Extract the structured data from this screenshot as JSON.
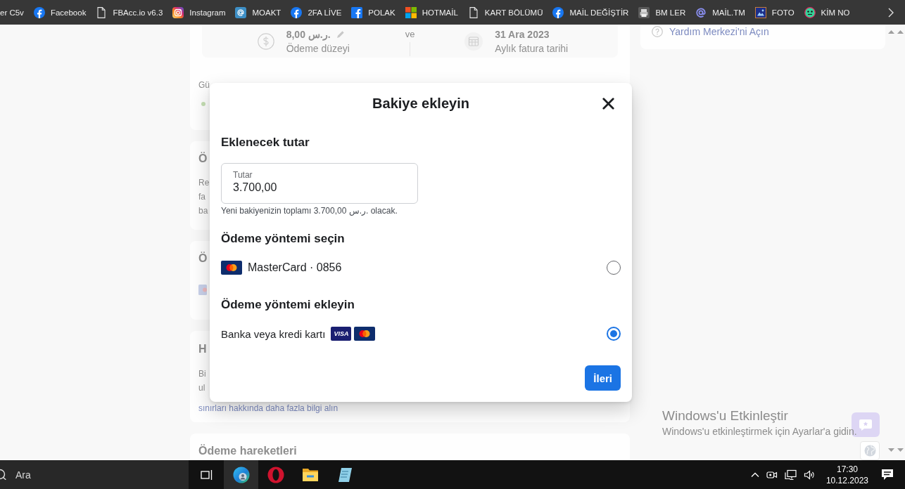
{
  "bookmarks_bar": {
    "items": [
      {
        "kind": "none",
        "label": "er C5v"
      },
      {
        "kind": "facebook",
        "label": "Facebook"
      },
      {
        "kind": "document",
        "label": "FBAcc.io v6.3"
      },
      {
        "kind": "instagram",
        "label": "Instagram"
      },
      {
        "kind": "at",
        "label": "MOAKT"
      },
      {
        "kind": "facebook",
        "label": "2FA LİVE"
      },
      {
        "kind": "square",
        "label": "POLAK"
      },
      {
        "kind": "windows",
        "label": "HOTMAİL"
      },
      {
        "kind": "document",
        "label": "KART BÖLÜMÜ"
      },
      {
        "kind": "facebook",
        "label": "MAİL DEĞİŞTİR"
      },
      {
        "kind": "printer",
        "label": "BM LER"
      },
      {
        "kind": "mention",
        "label": "MAİL.TM"
      },
      {
        "kind": "picture",
        "label": "FOTO"
      },
      {
        "kind": "smiley",
        "label": "KİM NO"
      }
    ]
  },
  "billing_page": {
    "summary_card": {
      "payment_level": {
        "value": "8,00 ر.س.",
        "label": "Ödeme düzeyi"
      },
      "separator": "ve",
      "billing_date": {
        "value": "31 Ara 2023",
        "label": "Aylık fatura tarihi"
      },
      "spending_limit": "Gü"
    },
    "cards": [
      {
        "kind": "text",
        "title": "Ö",
        "lines": [
          "Re",
          "fa",
          "ba"
        ]
      },
      {
        "kind": "method",
        "title": "Ö"
      },
      {
        "kind": "text",
        "title": "H",
        "lines": [
          "Bi",
          "ul"
        ],
        "link": "sınırları hakkında daha fazla bilgi alın"
      },
      {
        "kind": "heading",
        "title": "Ödeme hareketleri"
      }
    ],
    "help_card": {
      "link": "Yardım Merkezi'ni Açın"
    }
  },
  "add_funds_dialog": {
    "title": "Bakiye ekleyin",
    "amount": {
      "heading": "Eklenecek tutar",
      "field": {
        "label": "Tutar",
        "value": "3.700,00"
      },
      "hint": "Yeni bakiyenizin toplamı 3.700,00 ر.س. olacak."
    },
    "saved_methods": {
      "heading": "Ödeme yöntemi seçin",
      "options": [
        {
          "label": "MasterCard · 0856",
          "logos": [
            {
              "kind": "mastercard"
            }
          ],
          "selected": false
        }
      ]
    },
    "new_methods": {
      "heading": "Ödeme yöntemi ekleyin",
      "options": [
        {
          "label": "Banka veya kredi kartı",
          "logos": [
            {
              "kind": "visa",
              "text": "VISA"
            },
            {
              "kind": "mastercard"
            }
          ],
          "selected": true
        }
      ]
    },
    "next_button": "İleri"
  },
  "activation_notice": {
    "title": "Windows'u Etkinleştir",
    "text": "Windows'u etkinleştirmek için Ayarlar'a gidin."
  },
  "taskbar": {
    "search": {
      "placeholder": "Ara"
    },
    "apps": [
      {
        "kind": "taskview",
        "selected": false
      },
      {
        "kind": "edge",
        "selected": true
      },
      {
        "kind": "opera",
        "selected": false
      },
      {
        "kind": "explorer",
        "selected": false
      },
      {
        "kind": "notes",
        "selected": false
      }
    ],
    "clock": {
      "time": "17:30",
      "date": "10.12.2023"
    }
  }
}
